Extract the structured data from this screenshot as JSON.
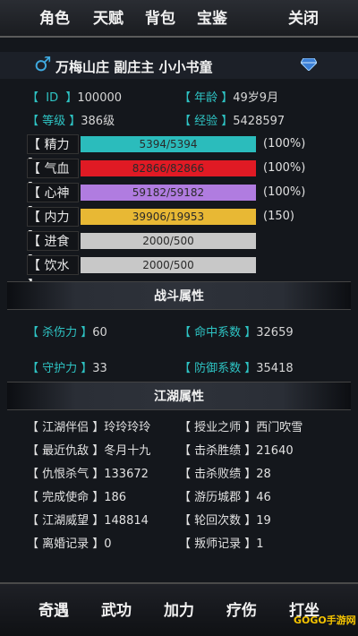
{
  "tabs": [
    "角色",
    "天赋",
    "背包",
    "宝鉴"
  ],
  "close_label": "关闭",
  "profile": {
    "gender_symbol": "♂",
    "name": "万梅山庄  副庄主  小小书童"
  },
  "info": {
    "id_label": "【  ID  】",
    "id_value": "100000",
    "age_label": "【 年龄 】",
    "age_value": "49岁9月",
    "level_label": "【 等级 】",
    "level_value": "386级",
    "exp_label": "【 经验 】",
    "exp_value": "5428597"
  },
  "stats": [
    {
      "label": "【 精力 】",
      "text": "5394/5394",
      "fill": 1.0,
      "color": "#2bbcbc",
      "pct": "(100%)"
    },
    {
      "label": "【 气血 】",
      "text": "82866/82866",
      "fill": 1.0,
      "color": "#e01a24",
      "pct": "(100%)"
    },
    {
      "label": "【 心神 】",
      "text": "59182/59182",
      "fill": 1.0,
      "color": "#b07ce0",
      "pct": "(100%)"
    },
    {
      "label": "【 内力 】",
      "text": "39906/19953",
      "fill": 1.0,
      "color": "#e8b834",
      "pct": "(150)"
    },
    {
      "label": "【 进食 】",
      "text": "2000/500",
      "fill": 1.0,
      "color": "#c8c8c8",
      "pct": ""
    },
    {
      "label": "【 饮水 】",
      "text": "2000/500",
      "fill": 1.0,
      "color": "#c8c8c8",
      "pct": ""
    }
  ],
  "combat": {
    "title": "战斗属性",
    "rows": [
      {
        "l1": "【 杀伤力 】",
        "v1": "60",
        "l2": "【 命中系数 】",
        "v2": "32659"
      },
      {
        "l1": "【 守护力 】",
        "v1": "33",
        "l2": "【 防御系数 】",
        "v2": "35418"
      }
    ]
  },
  "jianghu": {
    "title": "江湖属性",
    "rows": [
      {
        "l1": "【 江湖伴侣 】",
        "v1": "玲玲玲玲",
        "l2": "【 授业之师 】",
        "v2": "西门吹雪"
      },
      {
        "l1": "【 最近仇敌 】",
        "v1": "冬月十九",
        "l2": "【 击杀胜绩 】",
        "v2": "21640"
      },
      {
        "l1": "【 仇恨杀气 】",
        "v1": "133672",
        "l2": "【 击杀败绩 】",
        "v2": "28"
      },
      {
        "l1": "【 完成使命 】",
        "v1": "186",
        "l2": "【 游历城郡 】",
        "v2": "46"
      },
      {
        "l1": "【 江湖威望 】",
        "v1": "148814",
        "l2": "【 轮回次数 】",
        "v2": "19"
      },
      {
        "l1": "【 离婚记录 】",
        "v1": "0",
        "l2": "【 叛师记录 】",
        "v2": "1"
      }
    ]
  },
  "bottom_buttons": [
    "奇遇",
    "武功",
    "加力",
    "疗伤",
    "打坐"
  ],
  "watermark": "GOGO手游网"
}
